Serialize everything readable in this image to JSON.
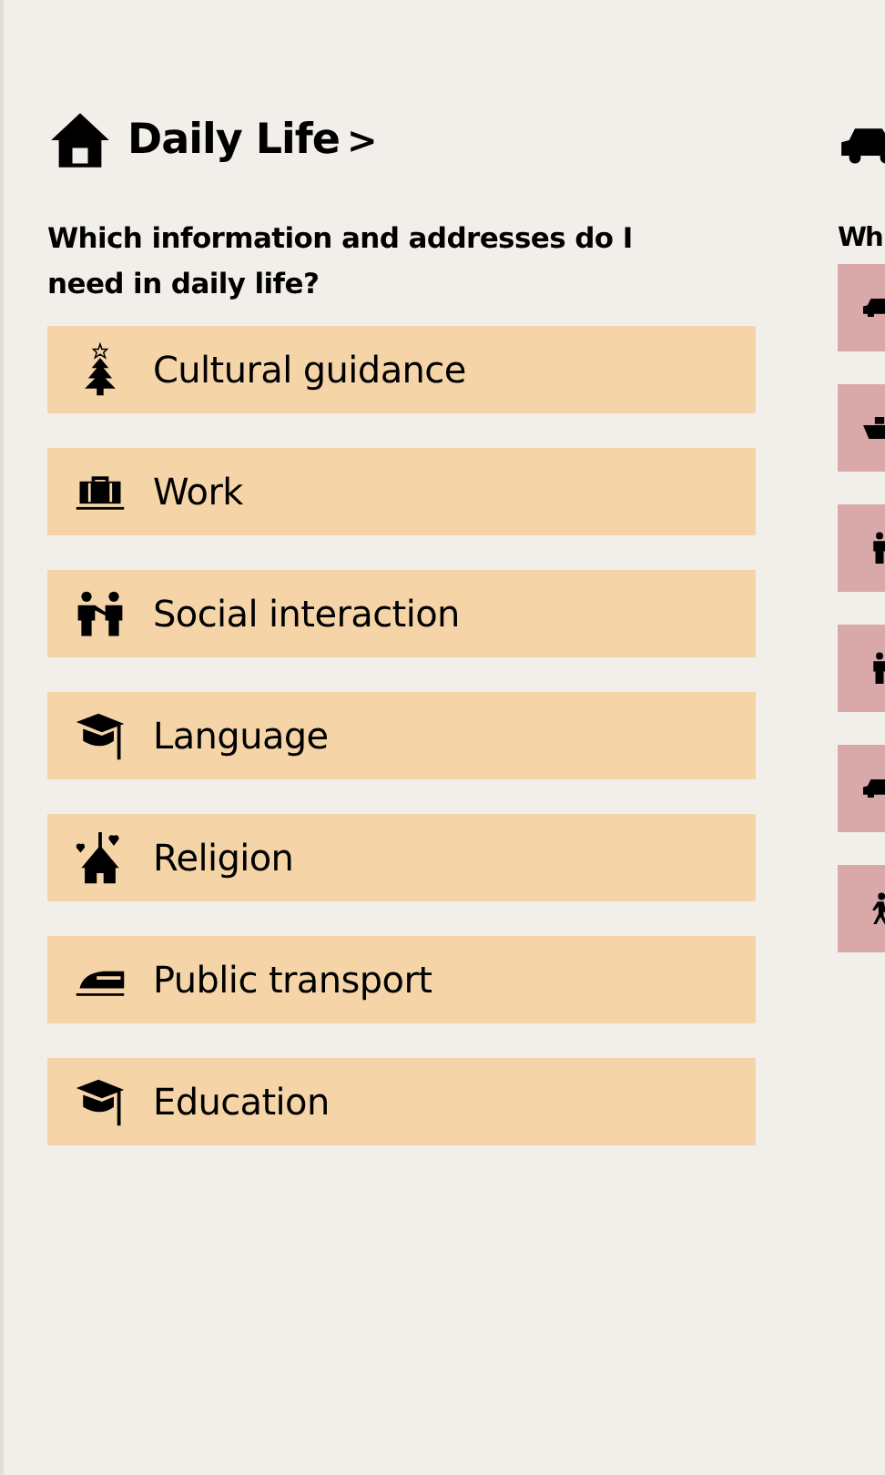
{
  "sections": [
    {
      "header": {
        "kind": "house",
        "title": "Daily Life",
        "chevron": ">"
      },
      "question": "Which information and addresses do I need in daily life?",
      "color": "#f5d5a8",
      "items": [
        {
          "label": "Cultural guidance",
          "kind": "tree"
        },
        {
          "label": "Work",
          "kind": "suitcase"
        },
        {
          "label": "Social interaction",
          "kind": "people"
        },
        {
          "label": "Language",
          "kind": "cap"
        },
        {
          "label": "Religion",
          "kind": "church"
        },
        {
          "label": "Public transport",
          "kind": "train"
        },
        {
          "label": "Education",
          "kind": "cap"
        }
      ]
    },
    {
      "header": {
        "kind": "car"
      },
      "question": "Wh",
      "color": "#d9a8a8",
      "items": [
        {
          "kind": "car"
        },
        {
          "kind": "ship"
        },
        {
          "kind": "person"
        },
        {
          "kind": "person"
        },
        {
          "kind": "car"
        },
        {
          "kind": "walker"
        }
      ]
    }
  ]
}
